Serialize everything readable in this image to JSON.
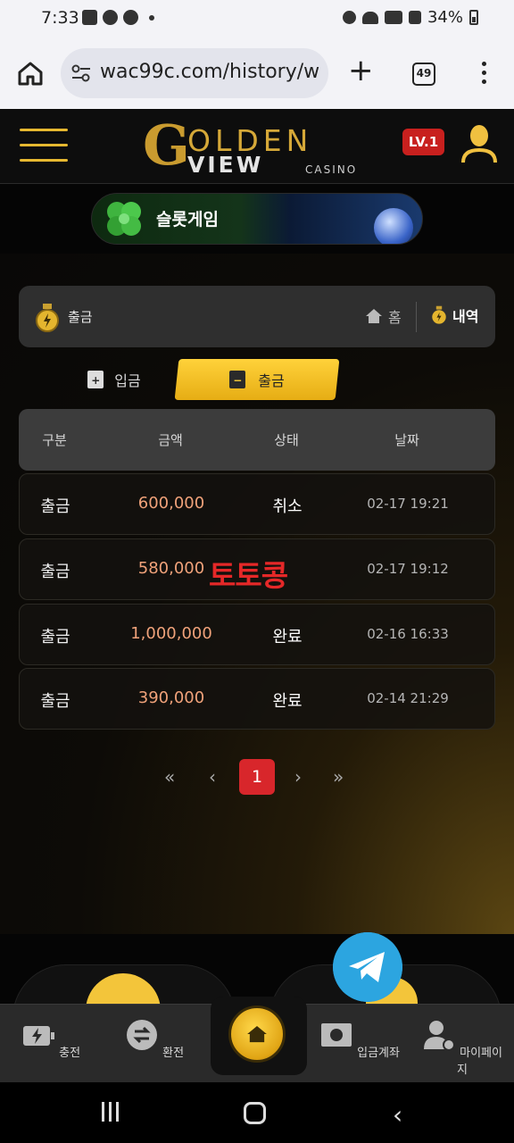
{
  "status_bar": {
    "time": "7:33",
    "battery": "34%"
  },
  "browser": {
    "url": "wac99c.com/history/w",
    "tab_count": "49"
  },
  "header": {
    "logo_g": "G",
    "logo_olden": "OLDEN",
    "logo_view": "VIEW",
    "logo_casino": "CASINO",
    "level_badge": "LV.1"
  },
  "banner": {
    "label": "슬롯게임"
  },
  "breadcrumb": {
    "title": "출금",
    "home": "홈",
    "history": "내역"
  },
  "tabs": {
    "deposit": "입금",
    "withdraw": "출금"
  },
  "table": {
    "headers": [
      "구분",
      "금액",
      "상태",
      "날짜"
    ],
    "rows": [
      {
        "type": "출금",
        "amount": "600,000",
        "status": "취소",
        "date": "02-17 19:21"
      },
      {
        "type": "출금",
        "amount": "580,000",
        "status": "",
        "date": "02-17 19:12"
      },
      {
        "type": "출금",
        "amount": "1,000,000",
        "status": "완료",
        "date": "02-16 16:33"
      },
      {
        "type": "출금",
        "amount": "390,000",
        "status": "완료",
        "date": "02-14 21:29"
      }
    ]
  },
  "watermark": "토토콩",
  "pagination": {
    "first": "«",
    "prev": "‹",
    "current": "1",
    "next": "›",
    "last": "»"
  },
  "bottom_tabs": {
    "charge": "충전",
    "exchange": "환전",
    "deposit_account": "입금계좌",
    "mypage": "마이페이지"
  },
  "colors": {
    "accent_gold": "#f3c53a",
    "badge_red": "#c8201e",
    "amount_orange": "#f0a27a",
    "telegram_blue": "#2ca5e0"
  }
}
